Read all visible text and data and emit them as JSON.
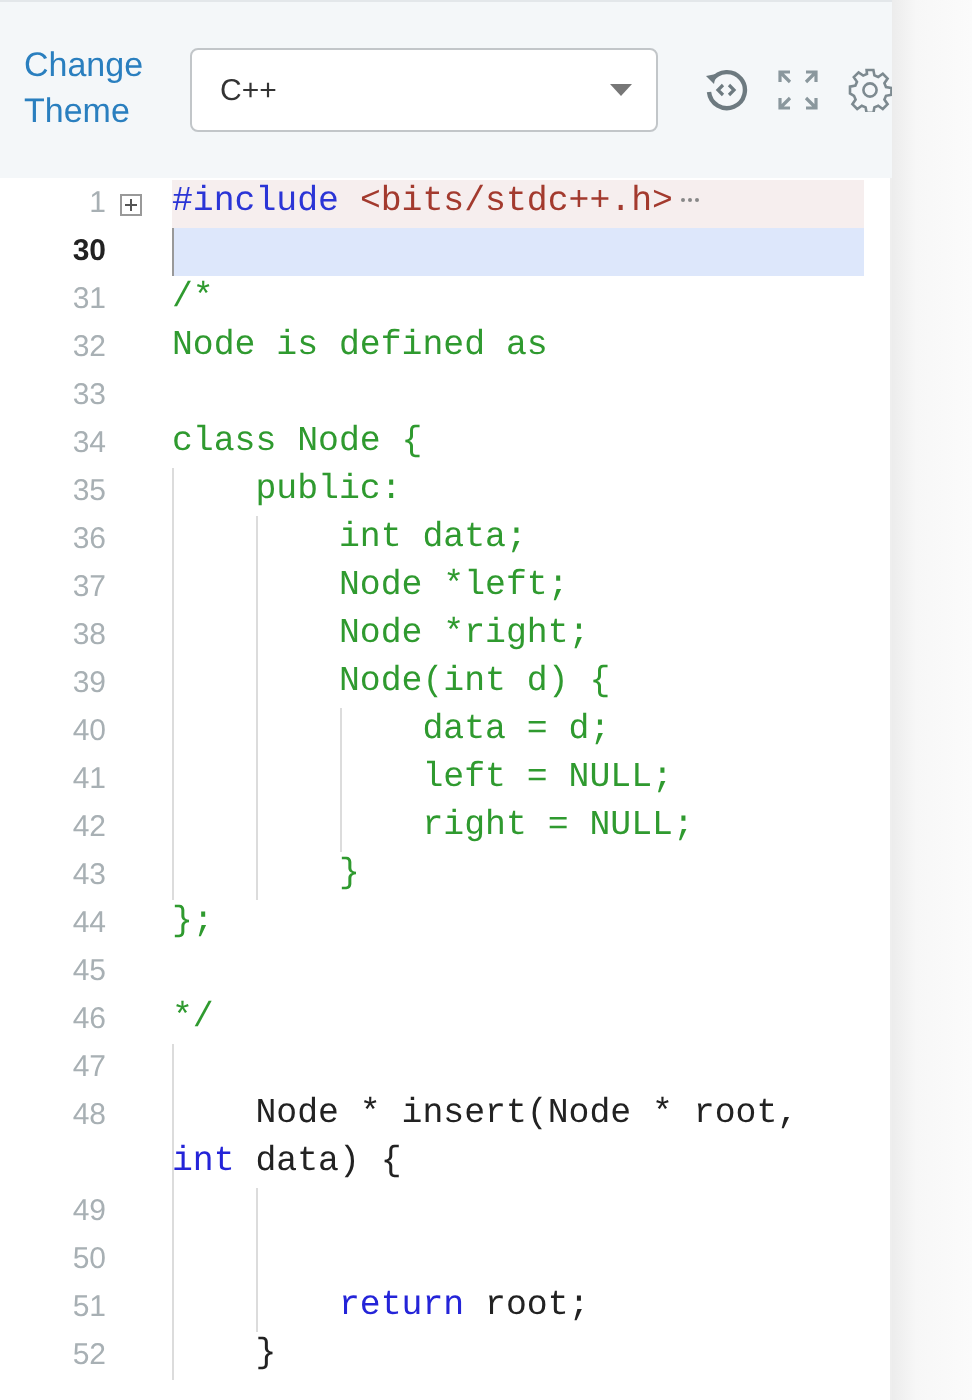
{
  "toolbar": {
    "theme_link": "Change Theme",
    "language_select": {
      "value": "C++"
    }
  },
  "editor": {
    "lines": [
      {
        "number": "1",
        "folded": true,
        "active": false,
        "tokens": [
          {
            "kind": "preprocessor",
            "text": "#include "
          },
          {
            "kind": "string",
            "text": "<bits/stdc++.h>"
          }
        ]
      },
      {
        "number": "30",
        "active": true
      },
      {
        "number": "31",
        "active": false,
        "tokens": [
          {
            "kind": "comment",
            "text": "/*"
          }
        ]
      },
      {
        "number": "32",
        "active": false,
        "tokens": [
          {
            "kind": "comment",
            "text": "Node is defined as"
          }
        ]
      },
      {
        "number": "33",
        "active": false
      },
      {
        "number": "34",
        "active": false,
        "tokens": [
          {
            "kind": "comment",
            "text": "class Node {"
          }
        ]
      },
      {
        "number": "35",
        "active": false,
        "tokens": [
          {
            "kind": "comment",
            "text": "    public:"
          }
        ]
      },
      {
        "number": "36",
        "active": false,
        "tokens": [
          {
            "kind": "comment",
            "text": "        int data;"
          }
        ]
      },
      {
        "number": "37",
        "active": false,
        "tokens": [
          {
            "kind": "comment",
            "text": "        Node *left;"
          }
        ]
      },
      {
        "number": "38",
        "active": false,
        "tokens": [
          {
            "kind": "comment",
            "text": "        Node *right;"
          }
        ]
      },
      {
        "number": "39",
        "active": false,
        "tokens": [
          {
            "kind": "comment",
            "text": "        Node(int d) {"
          }
        ]
      },
      {
        "number": "40",
        "active": false,
        "tokens": [
          {
            "kind": "comment",
            "text": "            data = d;"
          }
        ]
      },
      {
        "number": "41",
        "active": false,
        "tokens": [
          {
            "kind": "comment",
            "text": "            left = NULL;"
          }
        ]
      },
      {
        "number": "42",
        "active": false,
        "tokens": [
          {
            "kind": "comment",
            "text": "            right = NULL;"
          }
        ]
      },
      {
        "number": "43",
        "active": false,
        "tokens": [
          {
            "kind": "comment",
            "text": "        }"
          }
        ]
      },
      {
        "number": "44",
        "active": false,
        "tokens": [
          {
            "kind": "comment",
            "text": "};"
          }
        ]
      },
      {
        "number": "45",
        "active": false
      },
      {
        "number": "46",
        "active": false,
        "tokens": [
          {
            "kind": "comment",
            "text": "*/"
          }
        ]
      },
      {
        "number": "47",
        "active": false
      },
      {
        "number": "48",
        "active": false,
        "tokens": [
          {
            "kind": "plain",
            "text": "    Node * insert(Node * root, "
          },
          {
            "kind": "keyword",
            "text": "int"
          },
          {
            "kind": "plain",
            "text": " data) {"
          }
        ]
      },
      {
        "number": "49",
        "active": false
      },
      {
        "number": "50",
        "active": false
      },
      {
        "number": "51",
        "active": false,
        "tokens": [
          {
            "kind": "keyword",
            "text": "        return"
          },
          {
            "kind": "plain",
            "text": " root;"
          }
        ]
      },
      {
        "number": "52",
        "active": false,
        "tokens": [
          {
            "kind": "plain",
            "text": "    }"
          }
        ]
      }
    ]
  }
}
